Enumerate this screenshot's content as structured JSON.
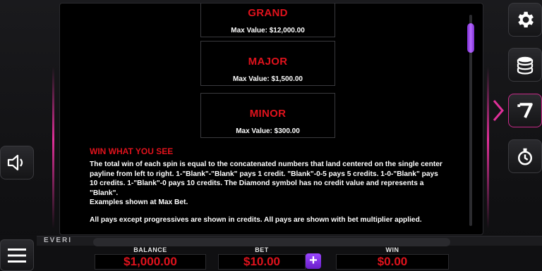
{
  "jackpots": [
    {
      "name": "GRAND",
      "value_label": "Max Value: $12,000.00"
    },
    {
      "name": "MAJOR",
      "value_label": "Max Value: $1,500.00"
    },
    {
      "name": "MINOR",
      "value_label": "Max Value: $300.00"
    }
  ],
  "rules": {
    "title": "WIN WHAT YOU SEE",
    "line1": "The total win of each spin is equal to the concatenated numbers that land centered on the single center",
    "line2": "payline from left to right. 1-\"Blank\"-\"Blank\" pays 1 credit. \"Blank\"-0-5 pays 5 credits. 1-0-\"Blank\" pays",
    "line3": "10 credits. 1-\"Blank\"-0 pays 10 credits. The Diamond symbol has no credit value and represents a",
    "line4": "\"Blank\".",
    "line5": "Examples shown at Max Bet.",
    "note": "All pays except progressives are shown in credits. All pays are shown with bet multiplier applied."
  },
  "brand": {
    "logo_text": "EVERI"
  },
  "meters": {
    "balance_label": "BALANCE",
    "balance_value": "$1,000.00",
    "bet_label": "BET",
    "bet_value": "$10.00",
    "win_label": "WIN",
    "win_value": "$0.00"
  },
  "controls": {
    "plus_symbol": "+"
  },
  "icons": {
    "settings": "gear-icon",
    "coins": "coin-stack-icon",
    "paytable": "seven-icon",
    "autoplay": "stopwatch-icon",
    "sound": "speaker-icon",
    "menu": "hamburger-icon"
  },
  "colors": {
    "accent_red": "#e0121c",
    "accent_purple": "#8a3cf0",
    "accent_pink": "#e0309a"
  }
}
